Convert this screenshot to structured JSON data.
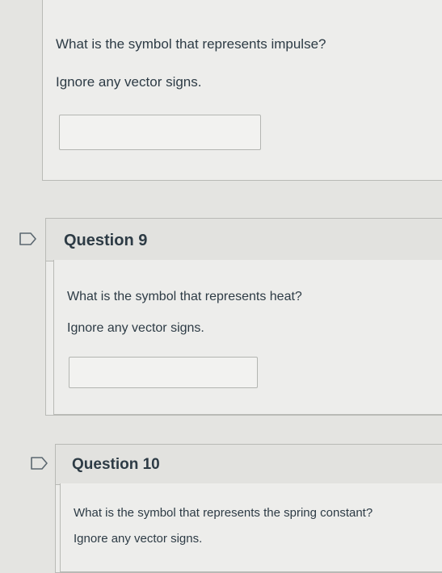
{
  "q8": {
    "prompt": "What is the symbol that represents impulse?",
    "note": "Ignore any vector signs.",
    "answer_value": ""
  },
  "q9": {
    "title": "Question 9",
    "prompt": "What is the symbol that represents heat?",
    "note": "Ignore any vector signs.",
    "answer_value": ""
  },
  "q10": {
    "title": "Question 10",
    "prompt": "What is the symbol that represents the spring constant?",
    "note": "Ignore any vector signs."
  },
  "colors": {
    "text": "#2d3b45",
    "border": "#b9bab6"
  }
}
